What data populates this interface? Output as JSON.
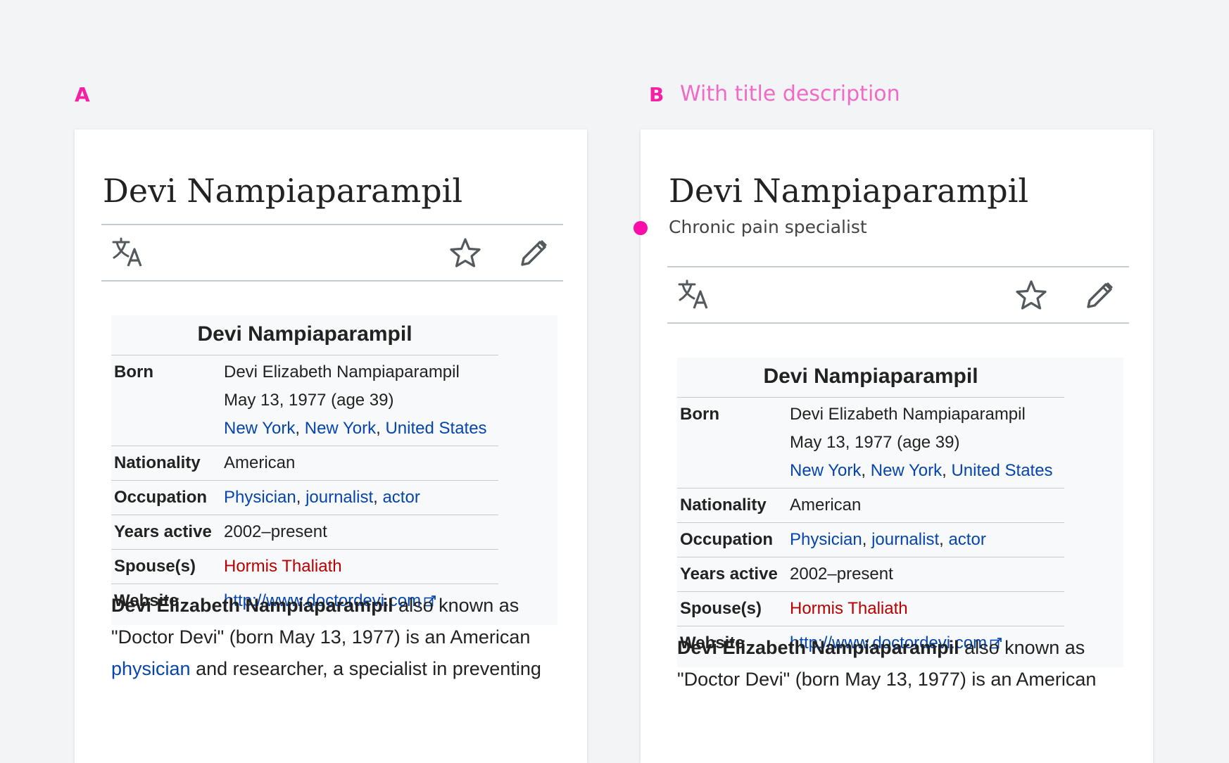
{
  "variants": [
    {
      "letter": "A",
      "description": "",
      "title": "Devi Nampiaparampil",
      "subtitle": "",
      "infobox": {
        "title": "Devi Nampiaparampil",
        "born": {
          "label": "Born",
          "name": "Devi Elizabeth Nampiaparampil",
          "date": "May 13, 1977 (age 39)",
          "place": [
            "New York",
            "New York",
            "United States"
          ]
        },
        "nationality": {
          "label": "Nationality",
          "value": "American"
        },
        "occupation": {
          "label": "Occupation",
          "values": [
            "Physician",
            "journalist",
            "actor"
          ]
        },
        "years_active": {
          "label": "Years active",
          "value": "2002–present"
        },
        "spouse": {
          "label": "Spouse(s)",
          "value": "Hormis Thaliath"
        },
        "website": {
          "label": "Website",
          "value": "http://www.doctordevi.com"
        }
      },
      "body": {
        "bold_name": "Devi Elizabeth Nampiaparampil",
        "text1": " also known as \"Doctor Devi\" (born May 13, 1977) is an American ",
        "link1": "physician",
        "text2": " and researcher, a specialist in preventing"
      }
    },
    {
      "letter": "B",
      "description": "With title description",
      "title": "Devi Nampiaparampil",
      "subtitle": "Chronic pain specialist",
      "infobox": {
        "title": "Devi Nampiaparampil",
        "born": {
          "label": "Born",
          "name": "Devi Elizabeth Nampiaparampil",
          "date": "May 13, 1977 (age 39)",
          "place": [
            "New York",
            "New York",
            "United States"
          ]
        },
        "nationality": {
          "label": "Nationality",
          "value": "American"
        },
        "occupation": {
          "label": "Occupation",
          "values": [
            "Physician",
            "journalist",
            "actor"
          ]
        },
        "years_active": {
          "label": "Years active",
          "value": "2002–present"
        },
        "spouse": {
          "label": "Spouse(s)",
          "value": "Hormis Thaliath"
        },
        "website": {
          "label": "Website",
          "value": "http://www.doctordevi.com"
        }
      },
      "body": {
        "bold_name": "Devi Elizabeth Nampiaparampil",
        "text1": " also known as \"Doctor Devi\" (born May 13, 1977) is an American",
        "link1": "",
        "text2": ""
      }
    }
  ],
  "icons": {
    "translate": "translate-icon",
    "star": "star-icon",
    "edit": "pencil-icon",
    "external": "external-link-icon"
  },
  "colors": {
    "accent_pink": "#f71fa4",
    "link": "#0645ad",
    "redlink": "#ba0000"
  }
}
